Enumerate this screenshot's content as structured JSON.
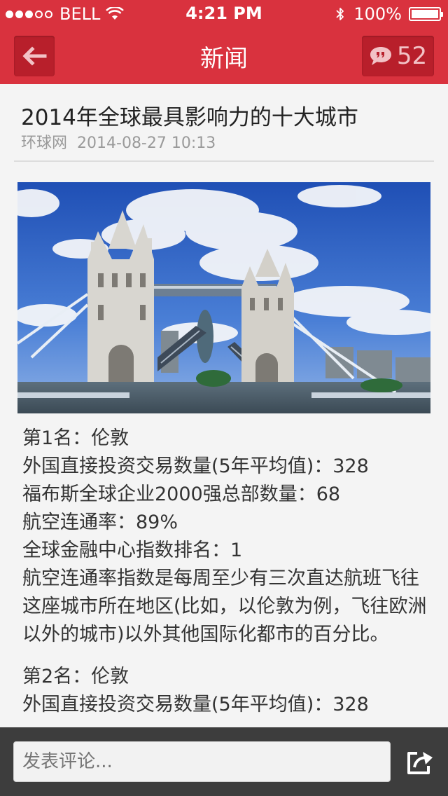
{
  "status": {
    "carrier": "BELL",
    "time": "4:21 PM",
    "battery": "100%",
    "signal_bars": 3,
    "signal_total": 5
  },
  "nav": {
    "title": "新闻",
    "comment_count": "52"
  },
  "article": {
    "title": "2014年全球最具影响力的十大城市",
    "source": "环球网",
    "date": "2014-08-27 10:13",
    "paragraphs": [
      "第1名：伦敦",
      "外国直接投资交易数量(5年平均值)：328",
      "福布斯全球企业2000强总部数量：68",
      "航空连通率：89%",
      "全球金融中心指数排名：1",
      "航空连通率指数是每周至少有三次直达航班飞往这座城市所在地区(比如，以伦敦为例，飞往欧洲以外的城市)以外其他国际化都市的百分比。",
      "第2名：伦敦",
      "外国直接投资交易数量(5年平均值)：328"
    ]
  },
  "comment_box": {
    "placeholder": "发表评论..."
  },
  "colors": {
    "brand_red": "#d9323e",
    "button_red": "#b81f2b",
    "bottom_bar": "#3d3d3d"
  }
}
